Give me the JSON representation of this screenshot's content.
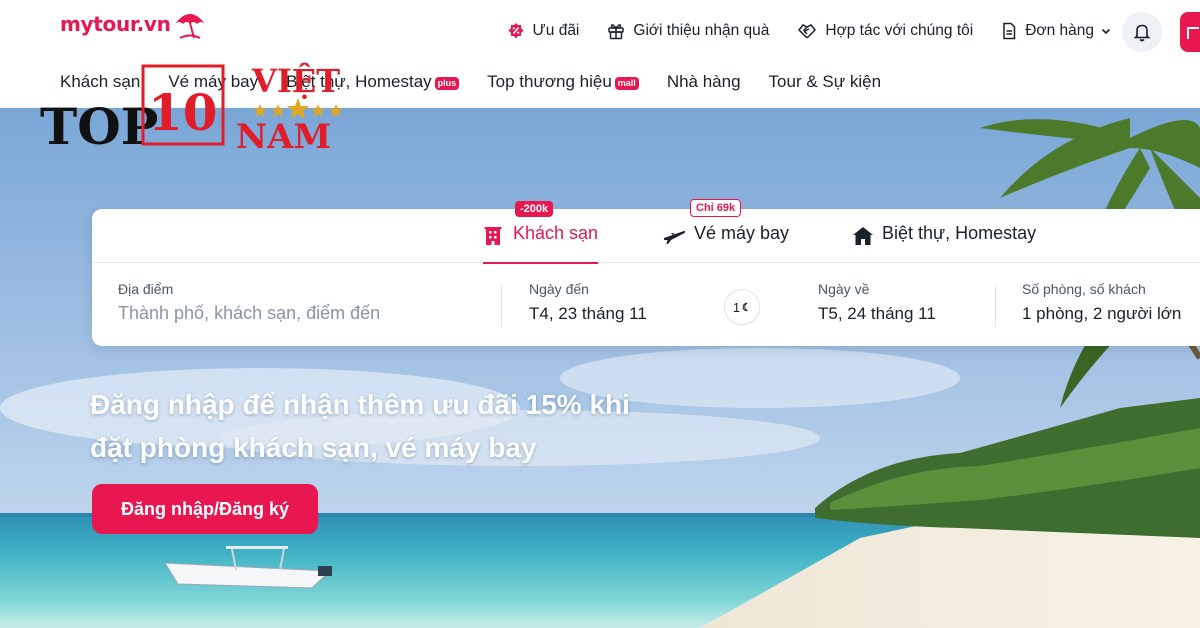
{
  "brand": {
    "logo_text": "mytour.vn",
    "accent": "#e8174f"
  },
  "topnav": {
    "items": [
      {
        "icon": "percent-badge-icon",
        "label": "Ưu đãi"
      },
      {
        "icon": "gift-icon",
        "label": "Giới thiệu nhận quà"
      },
      {
        "icon": "handshake-icon",
        "label": "Hợp tác với chúng tôi"
      },
      {
        "icon": "document-icon",
        "label": "Đơn hàng"
      }
    ]
  },
  "mainnav": {
    "items": [
      {
        "label": "Khách sạn",
        "badge": ""
      },
      {
        "label": "Vé máy bay",
        "badge": ""
      },
      {
        "label": "Biệt thự, Homestay",
        "badge": "plus"
      },
      {
        "label": "Top thương hiệu",
        "badge": "mall"
      },
      {
        "label": "Nhà hàng",
        "badge": ""
      },
      {
        "label": "Tour & Sự kiện",
        "badge": ""
      }
    ]
  },
  "watermark": {
    "top": "TOP",
    "number": "10",
    "word1": "VIỆT",
    "word2": "NAM"
  },
  "search": {
    "tabs": [
      {
        "label": "Khách sạn",
        "badge": "-200k",
        "icon": "hotel-icon"
      },
      {
        "label": "Vé máy bay",
        "badge": "Chỉ 69k",
        "icon": "airplane-icon"
      },
      {
        "label": "Biệt thự, Homestay",
        "badge": "",
        "icon": "house-icon"
      }
    ],
    "location": {
      "label": "Địa điểm",
      "placeholder": "Thành phố, khách sạn, điểm đến"
    },
    "checkin": {
      "label": "Ngày đến",
      "value": "T4, 23 tháng 11"
    },
    "nights": "1",
    "checkout": {
      "label": "Ngày về",
      "value": "T5, 24 tháng 11"
    },
    "guests": {
      "label": "Số phòng, số khách",
      "value": "1 phòng, 2 người lớn"
    }
  },
  "promo": {
    "line1": "Đăng nhập để nhận thêm ưu đãi 15% khi",
    "line2": "đặt phòng khách sạn, vé máy bay",
    "cta": "Đăng nhập/Đăng ký"
  }
}
